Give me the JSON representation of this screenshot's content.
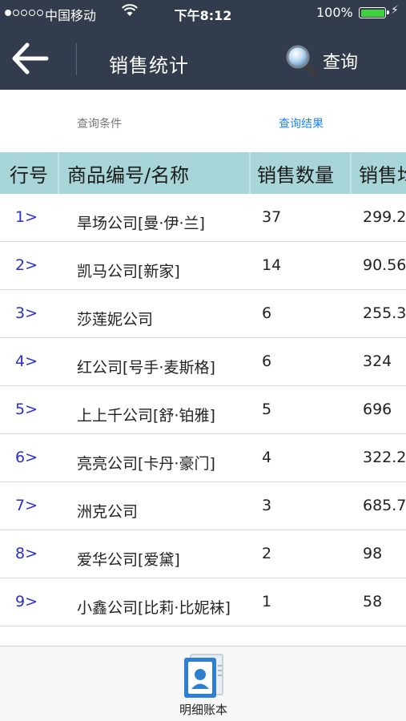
{
  "status": {
    "carrier": "中国移动",
    "time": "下午8:12",
    "battery": "100%"
  },
  "nav": {
    "title": "销售统计",
    "query_label": "查询"
  },
  "segments": {
    "conditions": "查询条件",
    "results": "查询结果"
  },
  "table": {
    "headers": {
      "num": "行号",
      "name": "商品编号/名称",
      "qty": "销售数量",
      "amount": "销售均"
    },
    "rows": [
      {
        "num": "1>",
        "name": "旱场公司[曼·伊·兰]",
        "qty": "37",
        "amount": "299.2"
      },
      {
        "num": "2>",
        "name": "凯马公司[新家]",
        "qty": "14",
        "amount": "90.56"
      },
      {
        "num": "3>",
        "name": "莎莲妮公司",
        "qty": "6",
        "amount": "255.3"
      },
      {
        "num": "4>",
        "name": "红公司[号手·麦斯格]",
        "qty": "6",
        "amount": "324"
      },
      {
        "num": "5>",
        "name": "上上千公司[舒·铂雅]",
        "qty": "5",
        "amount": "696"
      },
      {
        "num": "6>",
        "name": "亮亮公司[卡丹·豪门]",
        "qty": "4",
        "amount": "322.2"
      },
      {
        "num": "7>",
        "name": "洲克公司",
        "qty": "3",
        "amount": "685.7"
      },
      {
        "num": "8>",
        "name": "爱华公司[爱黛]",
        "qty": "2",
        "amount": "98"
      },
      {
        "num": "9>",
        "name": "小鑫公司[比莉·比妮袜]",
        "qty": "1",
        "amount": "58"
      }
    ]
  },
  "toolbar": {
    "ledger_label": "明细账本"
  },
  "colors": {
    "nav_bg": "#333c4c",
    "header_bg": "#a8d6d8",
    "accent": "#1f86e0",
    "row_num": "#2a2fd0"
  }
}
